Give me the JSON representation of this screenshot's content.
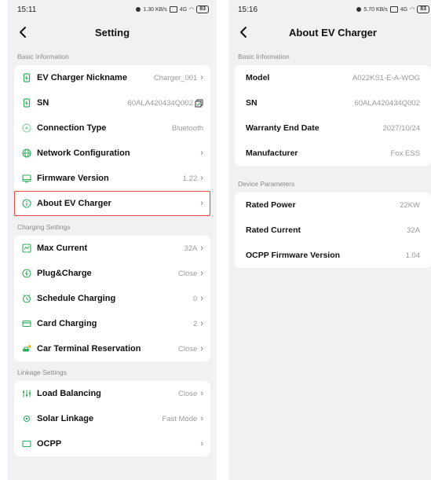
{
  "left": {
    "status": {
      "time": "15:11",
      "speed": "1.30 KB/s",
      "battery": "83"
    },
    "title": "Setting",
    "sections": [
      {
        "label": "Basic Information",
        "items": [
          {
            "icon": "charger-icon",
            "label": "EV Charger Nickname",
            "value": "Charger_001",
            "chevron": true
          },
          {
            "icon": "charger-icon",
            "label": "SN",
            "value": "60ALA420434Q002",
            "copy": true
          },
          {
            "icon": "connection-icon",
            "label": "Connection Type",
            "value": "Bluetooth"
          },
          {
            "icon": "globe-icon",
            "label": "Network Configuration",
            "value": "",
            "chevron": true
          },
          {
            "icon": "firmware-icon",
            "label": "Firmware Version",
            "value": "1.22",
            "chevron": true
          },
          {
            "icon": "info-icon",
            "label": "About EV Charger",
            "value": "",
            "chevron": true,
            "highlight": true
          }
        ]
      },
      {
        "label": "Charging Settings",
        "items": [
          {
            "icon": "current-icon",
            "label": "Max Current",
            "value": "32A",
            "chevron": true
          },
          {
            "icon": "plug-icon",
            "label": "Plug&Charge",
            "value": "Close",
            "chevron": true
          },
          {
            "icon": "clock-icon",
            "label": "Schedule Charging",
            "value": "0",
            "chevron": true
          },
          {
            "icon": "card-icon",
            "label": "Card Charging",
            "value": "2",
            "chevron": true
          },
          {
            "icon": "car-icon",
            "label": "Car Terminal Reservation",
            "value": "Close",
            "chevron": true
          }
        ]
      },
      {
        "label": "Linkage Settings",
        "items": [
          {
            "icon": "balance-icon",
            "label": "Load Balancing",
            "value": "Close",
            "chevron": true
          },
          {
            "icon": "sun-icon",
            "label": "Solar Linkage",
            "value": "Fast Mode",
            "chevron": true
          },
          {
            "icon": "ocpp-icon",
            "label": "OCPP",
            "value": "",
            "chevron": true
          }
        ]
      }
    ]
  },
  "right": {
    "status": {
      "time": "15:16",
      "speed": "5.70 KB/s",
      "battery": "83"
    },
    "title": "About EV Charger",
    "sections": [
      {
        "label": "Basic Information",
        "items": [
          {
            "label": "Model",
            "value": "A022KS1-E-A-WOG"
          },
          {
            "label": "SN",
            "value": "60ALA420434Q002"
          },
          {
            "label": "Warranty End Date",
            "value": "2027/10/24"
          },
          {
            "label": "Manufacturer",
            "value": "Fox ESS"
          }
        ]
      },
      {
        "label": "Device Parameters",
        "items": [
          {
            "label": "Rated Power",
            "value": "22KW"
          },
          {
            "label": "Rated Current",
            "value": "32A"
          },
          {
            "label": "OCPP Firmware Version",
            "value": "1.04"
          }
        ]
      }
    ]
  },
  "colors": {
    "accent": "#2fae5d",
    "highlight": "#e0493e",
    "background": "#f1f1f3"
  }
}
